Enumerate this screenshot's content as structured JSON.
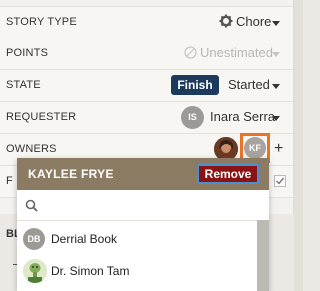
{
  "fields": {
    "story_type": {
      "label": "STORY TYPE",
      "value": "Chore"
    },
    "points": {
      "label": "POINTS",
      "value": "Unestimated"
    },
    "state": {
      "label": "STATE",
      "button": "Finish",
      "value": "Started"
    },
    "requester": {
      "label": "REQUESTER",
      "initials": "IS",
      "value": "Inara Serra"
    },
    "owners": {
      "label": "OWNERS",
      "owner_initials": "KF",
      "add": "+"
    },
    "hidden_row_label": "F"
  },
  "background_label": "BL",
  "dropdown": {
    "title": "KAYLEE FRYE",
    "remove_label": "Remove",
    "search_placeholder": "",
    "items": [
      {
        "initials": "DB",
        "name": "Derrial Book"
      },
      {
        "initials": "",
        "name": "Dr. Simon Tam"
      }
    ]
  },
  "colors": {
    "finish_button": "#1b3a5c",
    "remove_button": "#8a1212",
    "dropdown_header": "#8b7b62",
    "owner_highlight": "#e8742a"
  }
}
